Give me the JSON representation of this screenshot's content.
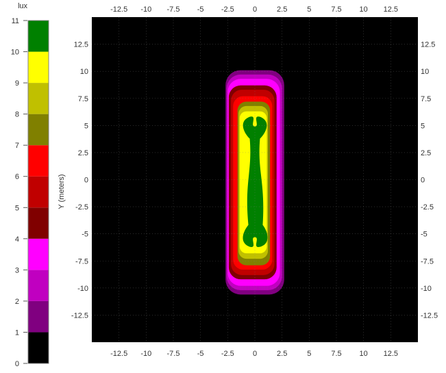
{
  "chart_data": {
    "type": "heatmap",
    "title": "",
    "xlabel": "",
    "ylabel": "Y (meters)",
    "xlim": [
      -15,
      15
    ],
    "ylim": [
      -15,
      15
    ],
    "x_ticks": [
      "-12.5",
      "-10",
      "-7.5",
      "-5",
      "-2.5",
      "0",
      "2.5",
      "5",
      "7.5",
      "10",
      "12.5"
    ],
    "y_ticks": [
      "12.5",
      "10",
      "7.5",
      "5",
      "2.5",
      "0",
      "-2.5",
      "-5",
      "-7.5",
      "-10",
      "-12.5"
    ],
    "background_color": "#000000",
    "colorbar": {
      "unit": "lux",
      "labels": [
        "0",
        "1",
        "2",
        "3",
        "4",
        "5",
        "6",
        "7",
        "8",
        "9",
        "10",
        "11"
      ],
      "bands": [
        {
          "from": 0,
          "to": 1,
          "color": "#000000"
        },
        {
          "from": 1,
          "to": 2,
          "color": "#800080"
        },
        {
          "from": 2,
          "to": 3,
          "color": "#c000c0"
        },
        {
          "from": 3,
          "to": 4,
          "color": "#ff00ff"
        },
        {
          "from": 4,
          "to": 5,
          "color": "#800000"
        },
        {
          "from": 5,
          "to": 6,
          "color": "#c00000"
        },
        {
          "from": 6,
          "to": 7,
          "color": "#ff0000"
        },
        {
          "from": 7,
          "to": 8,
          "color": "#808000"
        },
        {
          "from": 8,
          "to": 9,
          "color": "#c0c000"
        },
        {
          "from": 9,
          "to": 10,
          "color": "#ffff00"
        },
        {
          "from": 10,
          "to": 11,
          "color": "#008000"
        }
      ]
    },
    "contours": [
      {
        "level": 1,
        "color": "#800080",
        "x": [
          -2.7,
          2.7
        ],
        "y": [
          -10.6,
          10.1
        ]
      },
      {
        "level": 2,
        "color": "#c000c0",
        "x": [
          -2.6,
          2.5
        ],
        "y": [
          -10.2,
          9.7
        ]
      },
      {
        "level": 3,
        "color": "#ff00ff",
        "x": [
          -2.5,
          2.3
        ],
        "y": [
          -9.8,
          9.3
        ]
      },
      {
        "level": 4,
        "color": "#800000",
        "x": [
          -2.4,
          2.0
        ],
        "y": [
          -9.2,
          8.7
        ]
      },
      {
        "level": 5,
        "color": "#c00000",
        "x": [
          -2.2,
          1.8
        ],
        "y": [
          -8.8,
          8.3
        ]
      },
      {
        "level": 6,
        "color": "#ff0000",
        "x": [
          -2.0,
          1.6
        ],
        "y": [
          -8.3,
          7.7
        ]
      },
      {
        "level": 7,
        "color": "#808000",
        "x": [
          -1.6,
          1.4
        ],
        "y": [
          -7.9,
          7.2
        ]
      },
      {
        "level": 8,
        "color": "#c0c000",
        "x": [
          -1.5,
          1.2
        ],
        "y": [
          -7.3,
          6.8
        ]
      },
      {
        "level": 9,
        "color": "#ffff00",
        "x": [
          -1.4,
          1.1
        ],
        "y": [
          -6.8,
          6.3
        ]
      },
      {
        "level": 10,
        "color": "#008000",
        "x": [
          -1.1,
          1.1
        ],
        "y": [
          -6.2,
          5.8
        ],
        "shape": "dog-bone"
      }
    ]
  }
}
